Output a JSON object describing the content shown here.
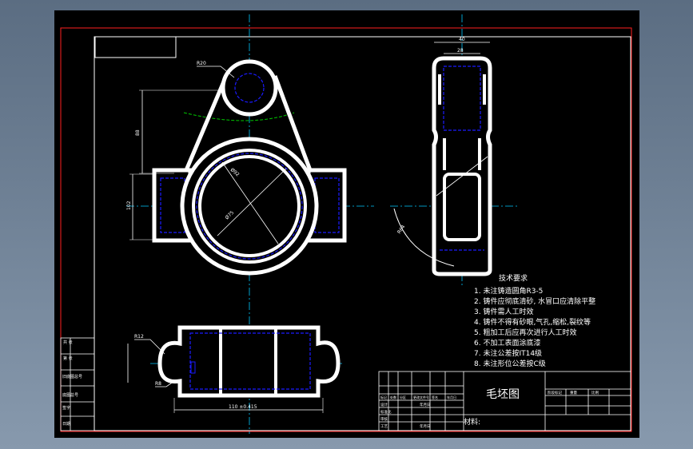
{
  "title_block": {
    "part_name": "毛坯图",
    "material_label": "材料:",
    "header_cells": [
      "标记",
      "处数",
      "分区",
      "更改文件号",
      "签名",
      "年月日"
    ],
    "left_rows": [
      "设计",
      "标准化",
      "审核",
      "工艺"
    ],
    "left_dates": [
      "年月日",
      "年月日"
    ],
    "right_header": [
      "阶段标记",
      "重量",
      "比例"
    ]
  },
  "side_table": {
    "rows": [
      "共 张",
      "第 张",
      "旧底图总号",
      "底图总号",
      "签字",
      "日期"
    ]
  },
  "technical_requirements": {
    "heading": "技术要求",
    "items": [
      "1. 未注铸造圆角R3-5",
      "2. 铸件应彻底清砂, 水冒口应清除平整",
      "3. 铸件需人工时效",
      "4. 铸件不得有砂眼,气孔,缩松,裂纹等",
      "5. 粗加工后应再次进行人工时效",
      "6. 不加工表面涂底漆",
      "7. 未注公差按IT14级",
      "8. 未注形位公差按C级"
    ]
  },
  "dimensions": {
    "top_boss_radius": "R20",
    "height_vertical": "88",
    "boss_width": "102",
    "outer_diameter": "Ø92",
    "bore_diameter": "Ø75",
    "side_width_total": "40",
    "side_width_inner": "28",
    "radius_side": "R64",
    "bottom_radius": "R12",
    "bottom_fillet": "R8",
    "bottom_length": "110 ±0.415"
  },
  "colors": {
    "background": "#000000",
    "outline": "#ffffff",
    "hidden": "#1a1aff",
    "center": "#00c8ff",
    "construction": "#00c800",
    "frame": "#ff2020",
    "dim": "#ffffff"
  }
}
